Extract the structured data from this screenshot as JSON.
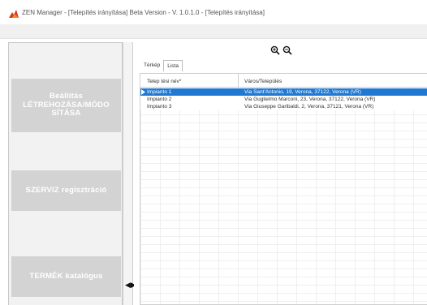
{
  "window": {
    "title": "ZEN Manager - [Telepítés irányítása] Beta Version - V. 1.0.1.0 - [Telepítés irányítása]"
  },
  "sidebar": {
    "buttons": [
      {
        "line1": "Beállítás",
        "line2": "LÉTREHOZÁSA/MÓDO",
        "line3": "SÍTÁSA"
      },
      {
        "label": "SZERVIZ regisztráció"
      },
      {
        "label": "TERMÉK katalógus"
      }
    ]
  },
  "toolbar": {
    "icons": [
      "zoom-in-icon",
      "zoom-out-icon"
    ]
  },
  "tabs": [
    {
      "label": "Térkép",
      "active": false
    },
    {
      "label": "Lista",
      "active": true
    }
  ],
  "table": {
    "columns": [
      "Telep tési név*",
      "Város/Település"
    ],
    "rows": [
      {
        "name": "Impianto 1",
        "address": "Via Sant'Antonio, 19, Verona, 37122, Verona (VR)",
        "selected": true
      },
      {
        "name": "Impianto 2",
        "address": "Via Guglielmo Marconi, 23, Verona, 37122, Verona (VR)",
        "selected": false
      },
      {
        "name": "Impianto 3",
        "address": "Via Giuseppe Garibaldi, 2, Verona, 37121, Verona (VR)",
        "selected": false
      }
    ]
  },
  "colors": {
    "selection": "#1f78d1",
    "button_bg": "#d3d3d3",
    "button_text": "#ffffff",
    "app_icon": "#d9381e"
  }
}
